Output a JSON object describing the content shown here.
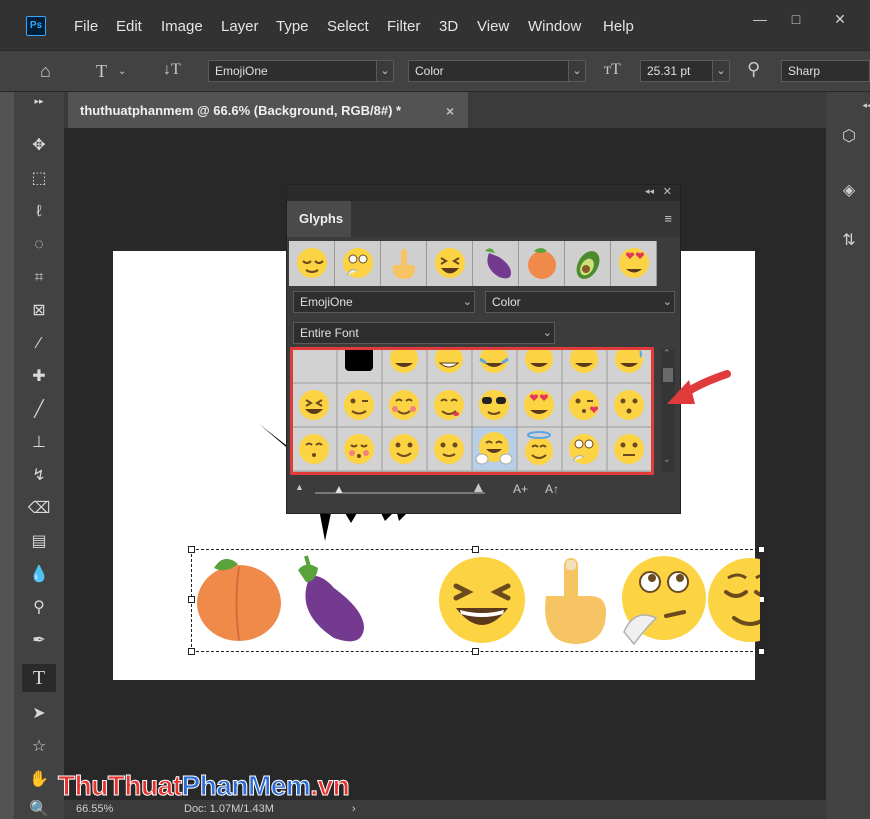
{
  "app": {
    "logo_text": "Ps"
  },
  "menu": [
    "File",
    "Edit",
    "Image",
    "Layer",
    "Type",
    "Select",
    "Filter",
    "3D",
    "View",
    "Window",
    "Help"
  ],
  "window_controls": {
    "minimize": "—",
    "maximize": "□",
    "close": "✕"
  },
  "options_bar": {
    "font_family": "EmojiOne",
    "font_style": "Color",
    "font_size": "25.31 pt",
    "anti_alias": "Sharp"
  },
  "document": {
    "tab_title": "thuthuatphanmem @ 66.6% (Background, RGB/8#) *",
    "close_glyph": "×"
  },
  "glyphs_panel": {
    "tab_label": "Glyphs",
    "font_family": "EmojiOne",
    "font_style": "Color",
    "filter": "Entire Font",
    "recent": [
      "😌",
      "🤔",
      "🖕",
      "😆",
      "🍆",
      "🍑",
      "🥑",
      "😍"
    ],
    "grid": [
      [
        "",
        "■",
        "😀",
        "😁",
        "😂",
        "😃",
        "😄",
        "😅"
      ],
      [
        "😆",
        "😉",
        "😊",
        "😋",
        "😎",
        "😍",
        "😘",
        "😗"
      ],
      [
        "😙",
        "😚",
        "🙂",
        "🙂",
        "🤗",
        "😇",
        "🤔",
        "😐"
      ]
    ],
    "selected_cell": "🤗"
  },
  "canvas_text": [
    "🍑",
    "🍆",
    "😆",
    "🖕",
    "🤔",
    "😌"
  ],
  "status": {
    "zoom": "66.55%",
    "doc_info": "Doc: 1.07M/1.43M"
  },
  "watermark": {
    "part1": "ThuThuat",
    "part2": "PhanMem",
    "part3": ".vn"
  },
  "colors": {
    "highlight": "#e03a3a",
    "ps_blue": "#31a8ff"
  }
}
